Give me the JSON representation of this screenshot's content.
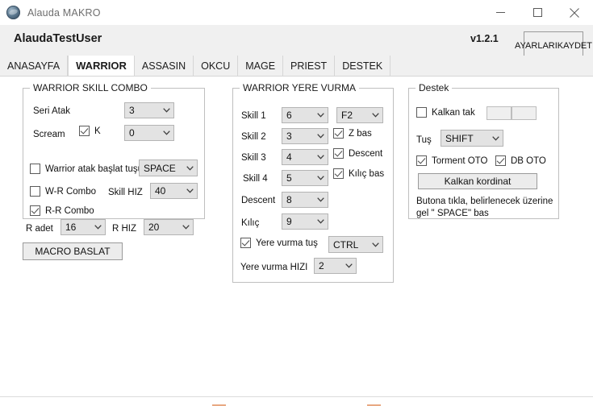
{
  "window": {
    "title": "Alauda MAKRO",
    "icon": "globe-icon",
    "minimize_label": "─",
    "maximize_label": "□",
    "close_label": "✕"
  },
  "header": {
    "username": "AlaudaTestUser",
    "version": "v1.2.1",
    "save_button_line1": "AYARLARI",
    "save_button_line2": "KAYDET"
  },
  "tabs": [
    {
      "label": "ANASAYFA",
      "active": false
    },
    {
      "label": "WARRIOR",
      "active": true
    },
    {
      "label": "ASSASIN",
      "active": false
    },
    {
      "label": "OKCU",
      "active": false
    },
    {
      "label": "MAGE",
      "active": false
    },
    {
      "label": "PRIEST",
      "active": false
    },
    {
      "label": "DESTEK",
      "active": false
    }
  ],
  "warrior_skill_combo": {
    "title": "WARRIOR SKILL COMBO",
    "seri_atak_label": "Seri Atak",
    "seri_atak_value": "3",
    "scream_label": "Scream",
    "scream_k_checkbox_label": "K",
    "scream_k_checked": true,
    "scream_value": "0",
    "warrior_atak_baslat_label": "Warrior atak başlat tuşu",
    "warrior_atak_baslat_checked": false,
    "warrior_atak_baslat_key": "SPACE",
    "wr_combo_label": "W-R Combo",
    "wr_combo_checked": false,
    "skill_hiz_label": "Skill HIZ",
    "skill_hiz_value": "40",
    "rr_combo_label": "R-R Combo",
    "rr_combo_checked": true,
    "r_adet_label": "R adet",
    "r_adet_value": "16",
    "r_hiz_label": "R HIZ",
    "r_hiz_value": "20",
    "macro_start_button": "MACRO BASLAT"
  },
  "warrior_yere_vurma": {
    "title": "WARRIOR YERE VURMA",
    "skill1_label": "Skill 1",
    "skill1_value": "6",
    "skill1_key": "F2",
    "skill2_label": "Skill 2",
    "skill2_value": "3",
    "skill3_label": "Skill 3",
    "skill3_value": "4",
    "skill4_label": "Skill 4",
    "skill4_value": "5",
    "descent_label": "Descent",
    "descent_value": "8",
    "kilic_label": "Kılıç",
    "kilic_value": "9",
    "z_bas_label": "Z bas",
    "z_bas_checked": true,
    "descent_cb_label": "Descent",
    "descent_cb_checked": true,
    "kilic_bas_label": "Kılıç bas",
    "kilic_bas_checked": true,
    "yere_vurma_tus_label": "Yere vurma tuş",
    "yere_vurma_tus_checked": true,
    "yere_vurma_tus_key": "CTRL",
    "yere_vurma_hizi_label": "Yere vurma HIZI",
    "yere_vurma_hizi_value": "2"
  },
  "destek": {
    "title": "Destek",
    "kalkan_tak_label": "Kalkan tak",
    "kalkan_tak_checked": false,
    "coord_x_value": "",
    "coord_y_value": "",
    "tus_label": "Tuş",
    "tus_value": "SHIFT",
    "torment_oto_label": "Torment OTO",
    "torment_oto_checked": true,
    "db_oto_label": "DB OTO",
    "db_oto_checked": true,
    "kalkan_kordinat_button": "Kalkan kordinat",
    "help_text": "Butona tıkla, belirlenecek üzerine gel \" SPACE\" bas"
  },
  "colors": {
    "header_band": "#f0f0f0",
    "combo_bg": "#e3e3e3",
    "panel_bg": "#ffffff",
    "border": "#bfbfbf"
  }
}
